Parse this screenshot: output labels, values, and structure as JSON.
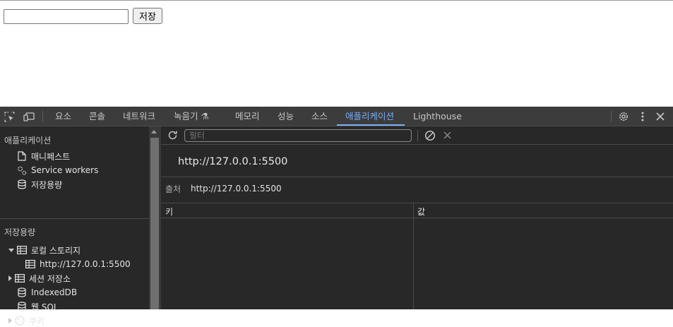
{
  "page": {
    "input_value": "",
    "save_button": "저장"
  },
  "devtools": {
    "tabs": [
      {
        "label": "요소"
      },
      {
        "label": "콘솔"
      },
      {
        "label": "네트워크"
      },
      {
        "label": "녹음기 ⚗"
      },
      {
        "label": "메모리"
      },
      {
        "label": "성능"
      },
      {
        "label": "소스"
      },
      {
        "label": "애플리케이션",
        "active": true
      },
      {
        "label": "Lighthouse"
      }
    ],
    "colors": {
      "accent": "#7cacf8",
      "panel_bg": "#282828",
      "tabbar_bg": "#3c3c3c"
    }
  },
  "sidebar": {
    "app_heading": "애플리케이션",
    "app_items": [
      {
        "label": "매니페스트",
        "icon": "file-icon"
      },
      {
        "label": "Service workers",
        "icon": "gears-icon"
      },
      {
        "label": "저장용량",
        "icon": "database-icon"
      }
    ],
    "storage_heading": "저장용량",
    "storage_items": [
      {
        "label": "로컬 스토리지",
        "icon": "table-icon",
        "expanded": true
      },
      {
        "label": "http://127.0.0.1:5500",
        "icon": "table-icon"
      },
      {
        "label": "세션 저장소",
        "icon": "table-icon",
        "expanded": false
      },
      {
        "label": "IndexedDB",
        "icon": "database-icon"
      },
      {
        "label": "웹 SQL",
        "icon": "database-icon"
      },
      {
        "label": "쿠키",
        "icon": "cookie-icon",
        "expanded": false
      }
    ]
  },
  "main": {
    "filter_placeholder": "필터",
    "origin_title": "http://127.0.0.1:5500",
    "source_label": "출처",
    "source_value": "http://127.0.0.1:5500",
    "columns": [
      "키",
      "값"
    ]
  }
}
